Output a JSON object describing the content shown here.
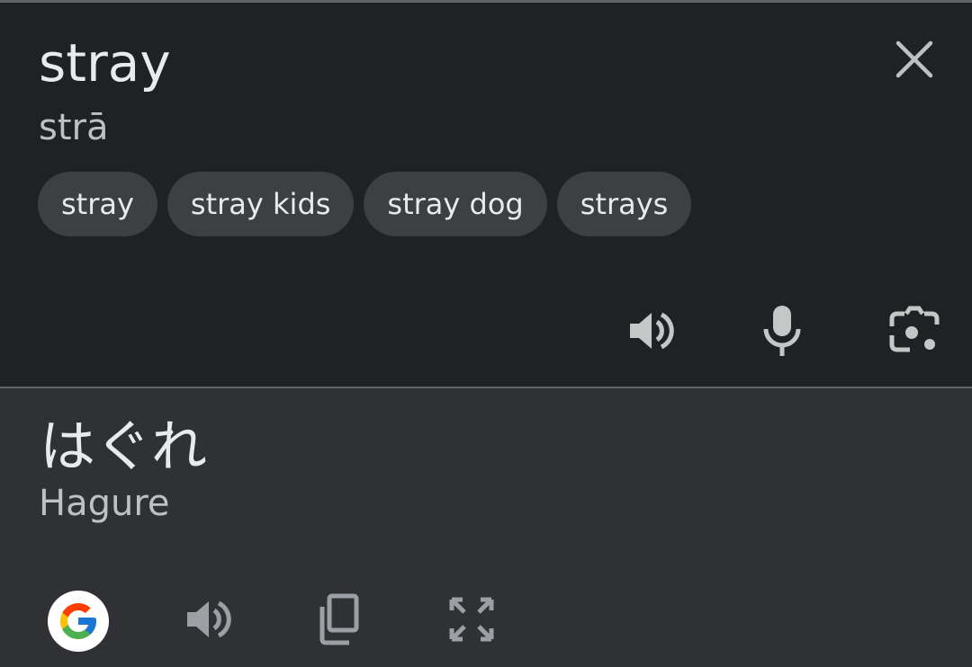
{
  "source": {
    "text": "stray",
    "transliteration": "strā",
    "suggestions": [
      {
        "label": "stray"
      },
      {
        "label": "stray kids"
      },
      {
        "label": "stray dog"
      },
      {
        "label": "strays"
      }
    ],
    "actions": {
      "close_icon": "close-icon",
      "speaker_icon": "speaker-icon",
      "mic_icon": "microphone-icon",
      "camera_icon": "lens-camera-icon"
    }
  },
  "target": {
    "text": "はぐれ",
    "transliteration": "Hagure",
    "actions": {
      "google_icon": "google-logo-icon",
      "speaker_icon": "speaker-icon",
      "copy_icon": "copy-icon",
      "fullscreen_icon": "fullscreen-icon"
    }
  },
  "colors": {
    "source_bg": "#202124",
    "target_bg": "#303134",
    "chip_bg": "#3c4043",
    "text_primary": "#e8eaed",
    "text_secondary": "#bdc1c6",
    "icon_gray": "#9aa0a6"
  }
}
